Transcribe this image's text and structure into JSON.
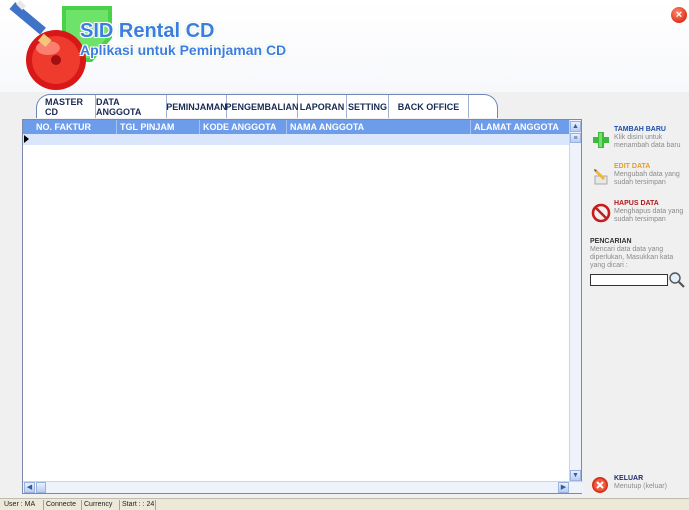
{
  "app": {
    "title": "SID Rental CD",
    "subtitle": "Aplikasi untuk Peminjaman CD"
  },
  "tabs": [
    {
      "label": "MASTER CD"
    },
    {
      "label": "DATA ANGGOTA"
    },
    {
      "label": "PEMINJAMAN"
    },
    {
      "label": "PENGEMBALIAN"
    },
    {
      "label": "LAPORAN"
    },
    {
      "label": "SETTING"
    },
    {
      "label": "BACK OFFICE"
    }
  ],
  "grid": {
    "columns": [
      {
        "label": "NO. FAKTUR"
      },
      {
        "label": "TGL PINJAM"
      },
      {
        "label": "KODE ANGGOTA"
      },
      {
        "label": "NAMA ANGGOTA"
      },
      {
        "label": "ALAMAT ANGGOTA"
      }
    ]
  },
  "actions": {
    "tambah": {
      "title": "TAMBAH BARU",
      "desc": "Klik disini untuk menambah data baru",
      "color": "#1f4fa8",
      "icon": "plus-icon"
    },
    "edit": {
      "title": "EDIT DATA",
      "desc": "Mengubah data yang sudah tersimpan",
      "color": "#e0a020",
      "icon": "pencil-icon"
    },
    "hapus": {
      "title": "HAPUS DATA",
      "desc": "Menghapus data yang sudah tersimpan",
      "color": "#b01818",
      "icon": "no-entry-icon"
    },
    "keluar": {
      "title": "KELUAR",
      "desc": "Menutup (keluar)",
      "color": "#1f2f6a",
      "icon": "exit-icon"
    }
  },
  "search": {
    "label": "PENCARIAN",
    "desc": "Mencari data data yang diperlukan, Masukkan kata yang dicari :",
    "value": ""
  },
  "statusbar": {
    "user": "User : MA",
    "connection": "Connecte",
    "currency": "Currency",
    "start": "Start : : 24"
  }
}
